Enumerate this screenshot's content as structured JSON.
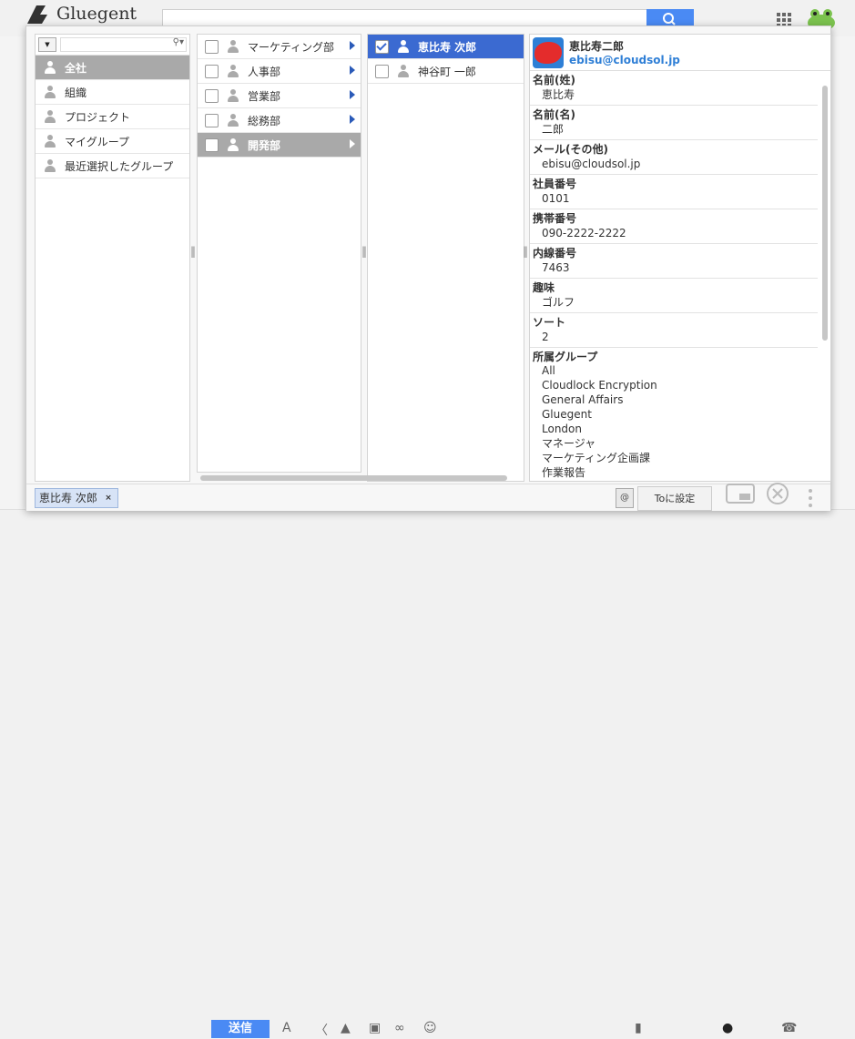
{
  "app": {
    "logo_text": "Gluegent"
  },
  "bottom_toolbar": {
    "send_label": "送信"
  },
  "filter": {
    "placeholder": ""
  },
  "column1": {
    "items": [
      {
        "label": "全社",
        "selected": true
      },
      {
        "label": "組織"
      },
      {
        "label": "プロジェクト"
      },
      {
        "label": "マイグループ"
      },
      {
        "label": "最近選択したグループ"
      }
    ]
  },
  "column2": {
    "items": [
      {
        "label": "マーケティング部"
      },
      {
        "label": "人事部"
      },
      {
        "label": "営業部"
      },
      {
        "label": "総務部"
      },
      {
        "label": "開発部",
        "selected": true
      }
    ]
  },
  "column3": {
    "items": [
      {
        "label": "恵比寿 次郎",
        "checked": true,
        "selected": true
      },
      {
        "label": "神谷町 一郎",
        "checked": false
      }
    ]
  },
  "detail": {
    "name": "恵比寿二郎",
    "email": "ebisu@cloudsol.jp",
    "fields": [
      {
        "label": "名前(姓)",
        "value": "恵比寿"
      },
      {
        "label": "名前(名)",
        "value": "二郎"
      },
      {
        "label": "メール(その他)",
        "value": "ebisu@cloudsol.jp"
      },
      {
        "label": "社員番号",
        "value": "0101"
      },
      {
        "label": "携帯番号",
        "value": "090-2222-2222"
      },
      {
        "label": "内線番号",
        "value": "7463"
      },
      {
        "label": "趣味",
        "value": "ゴルフ"
      },
      {
        "label": "ソート",
        "value": "2"
      }
    ],
    "groups_label": "所属グループ",
    "groups": [
      "All",
      "Cloudlock Encryption",
      "General Affairs",
      "Gluegent",
      "London",
      "マネージャ",
      "マーケティング企画課",
      "作業報告"
    ]
  },
  "selection": {
    "chip_label": "恵比寿 次郎",
    "chip_remove": "×"
  },
  "actions": {
    "to_button": "Toに設定",
    "at_icon": "@"
  }
}
